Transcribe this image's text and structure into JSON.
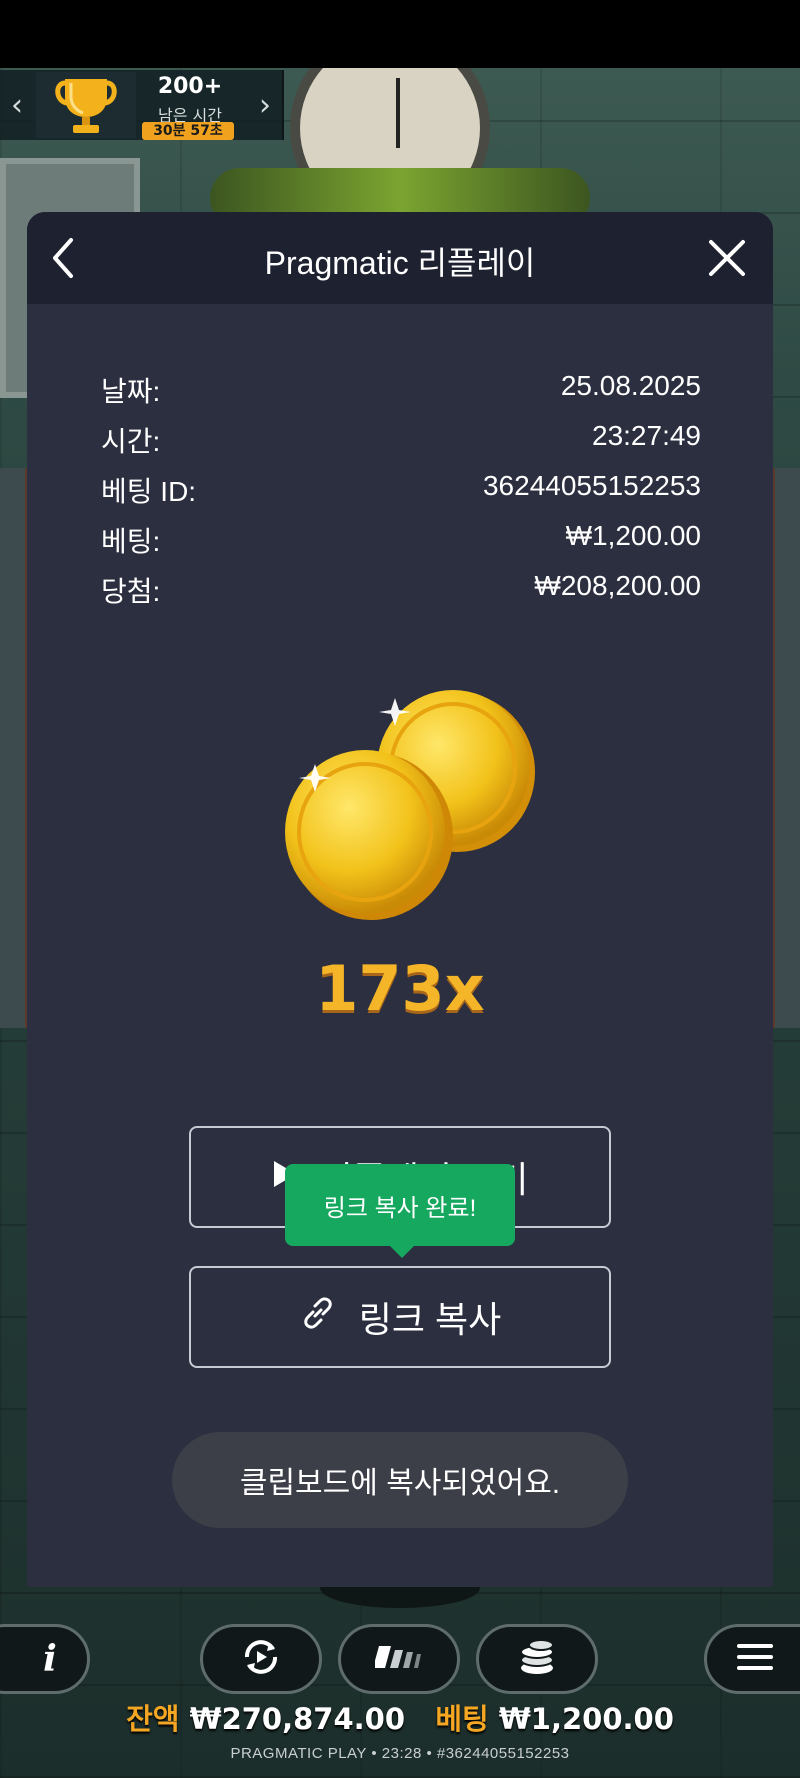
{
  "tournament": {
    "count": "200+",
    "remaining_label": "남은 시간",
    "time_left": "30분 57초"
  },
  "modal": {
    "title": "Pragmatic 리플레이",
    "rows": [
      {
        "label": "날짜:",
        "value": "25.08.2025"
      },
      {
        "label": "시간:",
        "value": "23:27:49"
      },
      {
        "label": "베팅 ID:",
        "value": "36244055152253"
      },
      {
        "label": "베팅:",
        "value": "₩1,200.00"
      },
      {
        "label": "당첨:",
        "value": "₩208,200.00"
      }
    ],
    "multiplier": "173x",
    "replay_button": "리플레이 보기",
    "copy_link_button": "링크 복사",
    "tooltip": "링크 복사 완료!",
    "toast": "클립보드에 복사되었어요."
  },
  "bottom": {
    "balance_label": "잔액",
    "balance_value": "₩270,874.00",
    "bet_label": "베팅",
    "bet_value": "₩1,200.00",
    "footer": "PRAGMATIC PLAY • 23:28 • #36244055152253"
  },
  "colors": {
    "accent_gold": "#f5a623",
    "tooltip_green": "#16a85f",
    "modal_bg": "#2c2f3f",
    "header_bg": "#1e2130"
  }
}
